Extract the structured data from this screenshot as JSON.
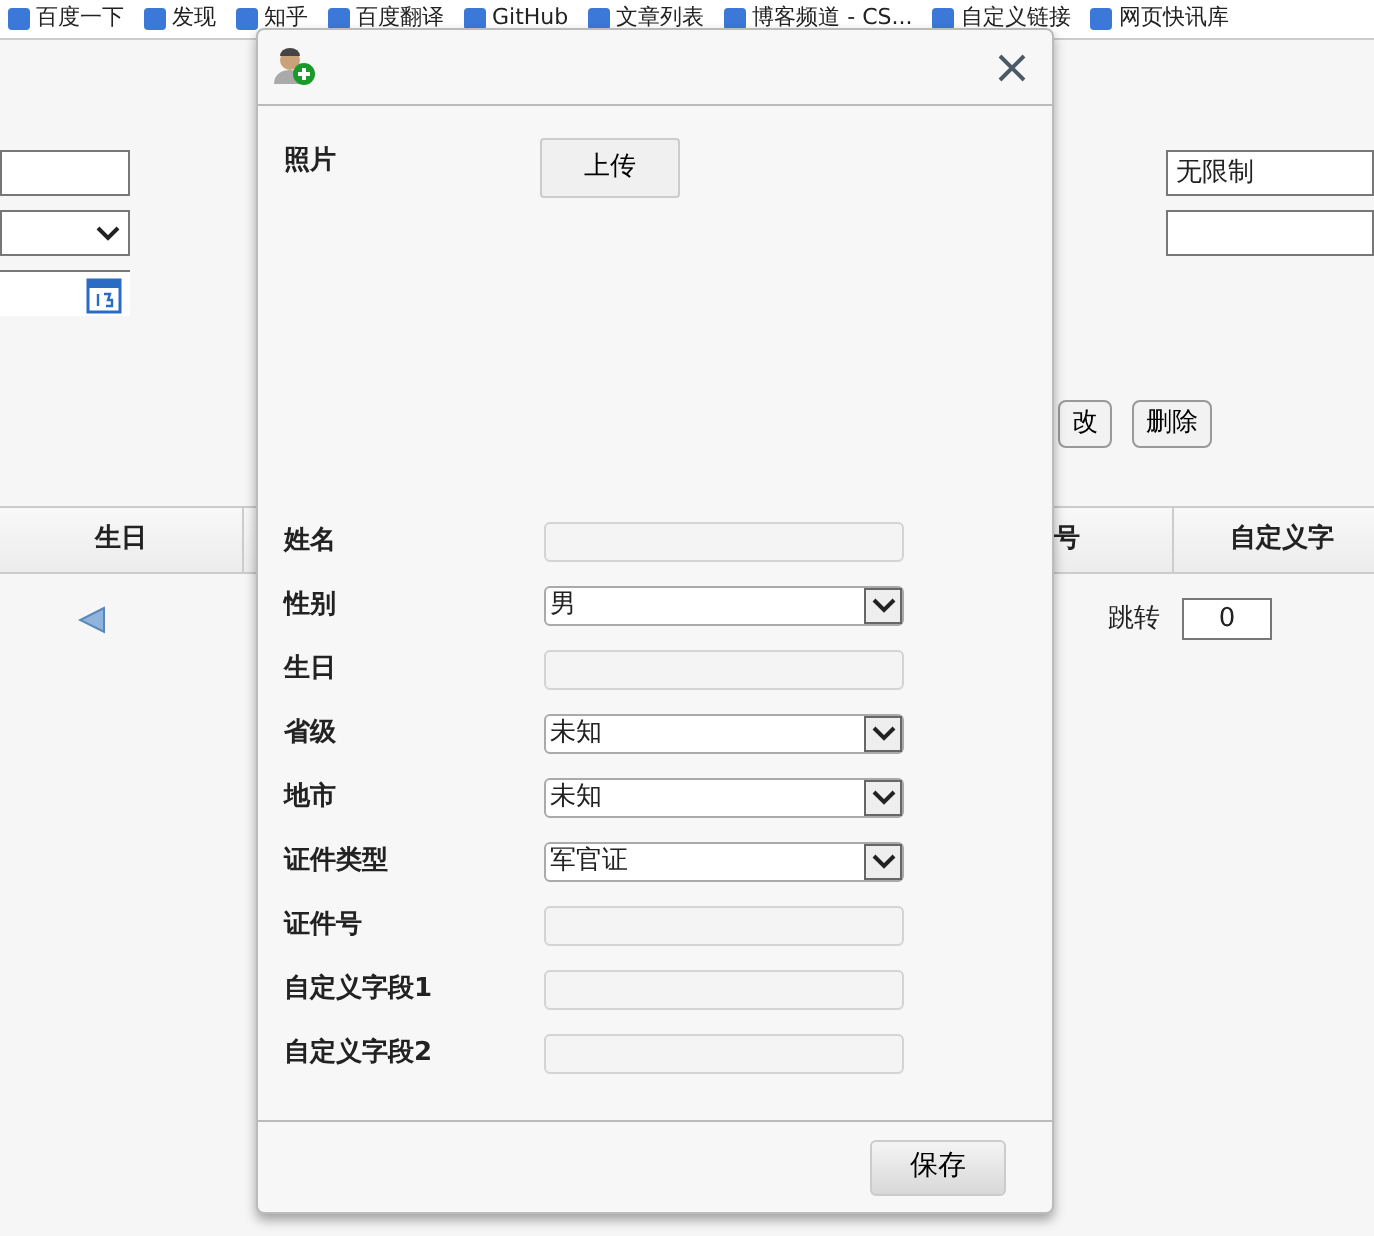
{
  "bookmarks": [
    {
      "label": "百度一下"
    },
    {
      "label": "发现"
    },
    {
      "label": "知乎"
    },
    {
      "label": "百度翻译"
    },
    {
      "label": "GitHub"
    },
    {
      "label": "文章列表"
    },
    {
      "label": "博客频道 - CS..."
    },
    {
      "label": "自定义链接"
    },
    {
      "label": "网页快讯库"
    }
  ],
  "page": {
    "left_fields": [
      {
        "kind": "text"
      },
      {
        "kind": "select"
      },
      {
        "kind": "date"
      }
    ],
    "right_fields": [
      {
        "kind": "text",
        "value": "无限制"
      },
      {
        "kind": "text"
      }
    ],
    "buttons": [
      "改",
      "删除"
    ],
    "table": {
      "columns": [
        "生日",
        "号",
        "自定义字"
      ]
    },
    "pager": {
      "jump_label": "跳转",
      "page_value": "0"
    }
  },
  "modal": {
    "photo_label": "照片",
    "upload_button": "上传",
    "fields": [
      {
        "label": "姓名",
        "kind": "text"
      },
      {
        "label": "性别",
        "kind": "select",
        "value": "男"
      },
      {
        "label": "生日",
        "kind": "text"
      },
      {
        "label": "省级",
        "kind": "select",
        "value": "未知"
      },
      {
        "label": "地市",
        "kind": "select",
        "value": "未知"
      },
      {
        "label": "证件类型",
        "kind": "select",
        "value": "军官证"
      },
      {
        "label": "证件号",
        "kind": "text"
      },
      {
        "label": "自定义字段1",
        "kind": "text"
      },
      {
        "label": "自定义字段2",
        "kind": "text"
      }
    ],
    "save_button": "保存"
  }
}
